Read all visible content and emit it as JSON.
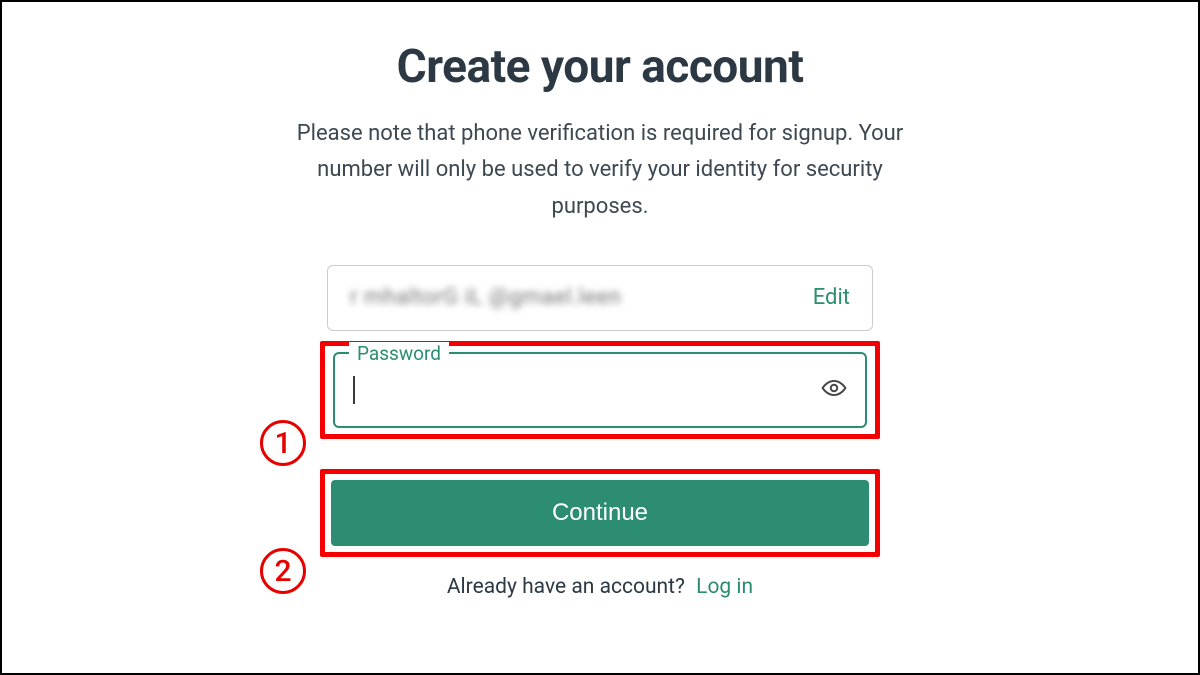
{
  "header": {
    "title": "Create your account",
    "note": "Please note that phone verification is required for signup. Your number will only be used to verify your identity for security purposes."
  },
  "email": {
    "value_blurred": "r mhaltorG iL @gmael.leen",
    "edit_label": "Edit"
  },
  "password": {
    "label": "Password",
    "value": ""
  },
  "actions": {
    "continue_label": "Continue",
    "already_text": "Already have an account?",
    "login_label": "Log in"
  },
  "annotations": {
    "callout_1": "1",
    "callout_2": "2"
  },
  "colors": {
    "accent": "#2c8d72",
    "highlight": "#f40000"
  }
}
